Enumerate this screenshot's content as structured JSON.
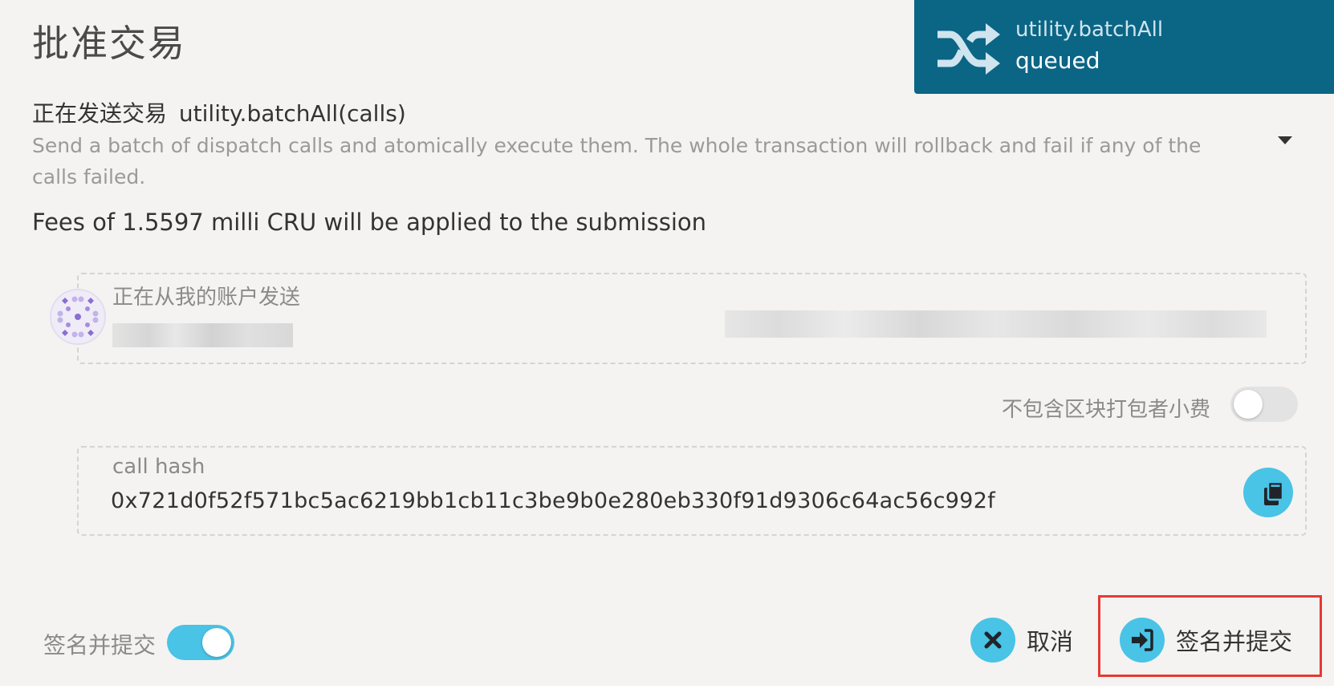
{
  "modal": {
    "title": "批准交易"
  },
  "toast": {
    "action": "utility.batchAll",
    "status": "queued",
    "icon": "shuffle-icon",
    "background": "#0b6585"
  },
  "call": {
    "prefix": "正在发送交易",
    "signature": "utility.batchAll(calls)",
    "description": "Send a batch of dispatch calls and atomically execute them. The whole transaction will rollback and fail if any of the calls failed."
  },
  "fees": {
    "text": "Fees of 1.5597 milli CRU will be applied to the submission"
  },
  "account": {
    "label": "正在从我的账户发送"
  },
  "tip": {
    "label": "不包含区块打包者小费",
    "enabled": false
  },
  "call_hash": {
    "label": "call hash",
    "value": "0x721d0f52f571bc5ac6219bb1cb11c3be9b0e280eb330f91d9306c64ac56c992f"
  },
  "footer": {
    "sign_toggle_label": "签名并提交",
    "sign_enabled": true,
    "cancel_label": "取消",
    "submit_label": "签名并提交"
  },
  "colors": {
    "accent": "#49c3e6",
    "highlight": "#e53935",
    "background": "#f4f3f1"
  }
}
